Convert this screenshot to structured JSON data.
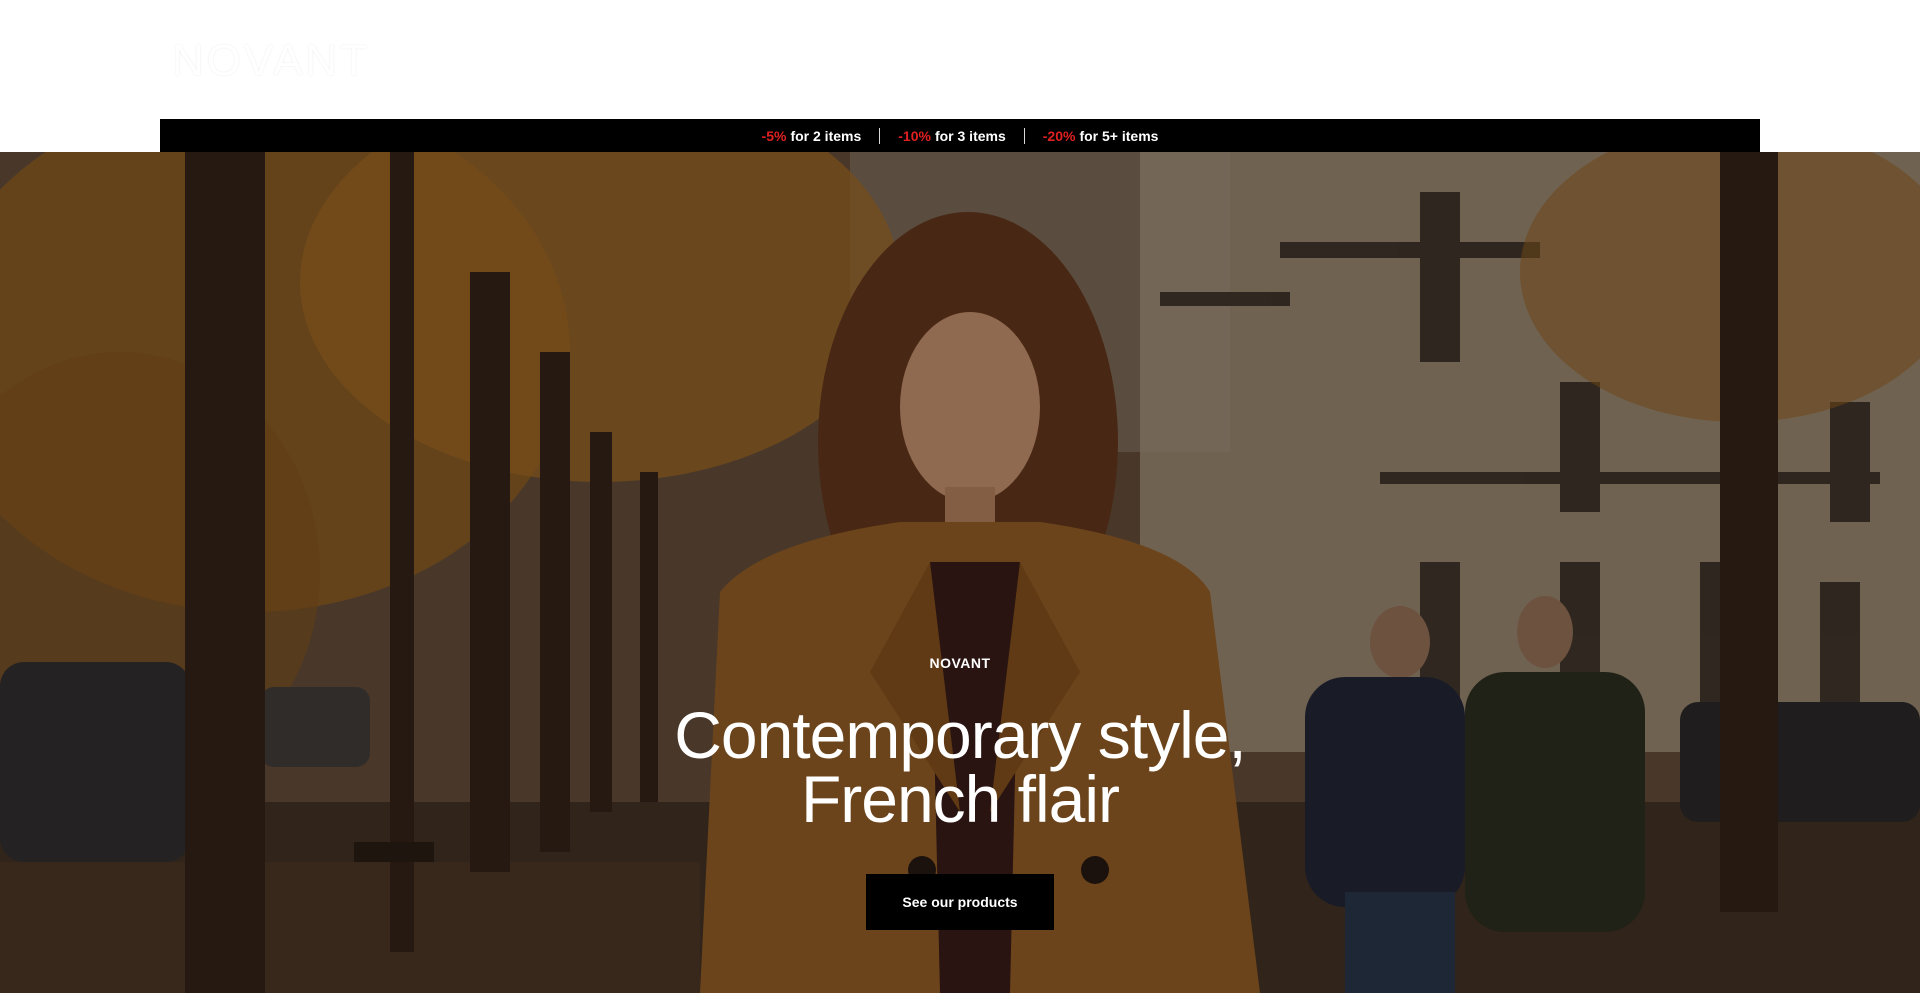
{
  "header": {
    "logo_text": "NOVANT"
  },
  "promo_bar": {
    "items": [
      {
        "discount": "-5%",
        "text": "for 2 items"
      },
      {
        "discount": "-10%",
        "text": "for 3 items"
      },
      {
        "discount": "-20%",
        "text": "for 5+ items"
      }
    ],
    "separator": "|"
  },
  "hero": {
    "eyebrow": "NOVANT",
    "title_line1": "Contemporary style,",
    "title_line2": "French flair",
    "cta_label": "See our products"
  },
  "colors": {
    "accent_discount": "#e02020",
    "promo_bg": "#000000",
    "cta_bg": "#000000",
    "text_light": "#ffffff"
  }
}
